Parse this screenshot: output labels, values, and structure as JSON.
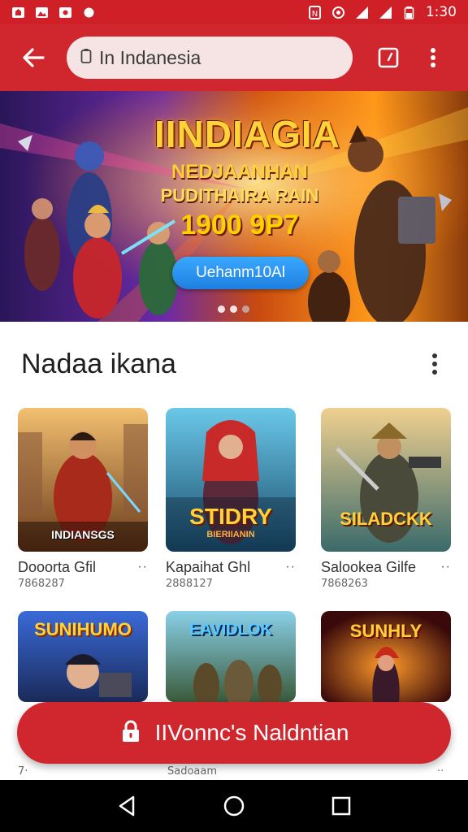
{
  "status_bar": {
    "time": "1:30",
    "left_icons": [
      "app-notification-icon",
      "gallery-icon",
      "photo-icon",
      "dot-icon"
    ],
    "right_icons": [
      "nfc-icon",
      "location-icon",
      "signal-icon",
      "signal-icon",
      "battery-icon"
    ]
  },
  "app_bar": {
    "url": "In Indanesia",
    "accent": "#d0262d"
  },
  "hero": {
    "title": "IINDIAGIA",
    "sub1": "NEDJAANHAN",
    "sub2": "PUDITHAIRA RAIN",
    "price": "1900 9P7",
    "cta": "Uehanm10Al",
    "slide_count": 3
  },
  "section": {
    "title": "Nadaa ikana"
  },
  "cards": [
    {
      "thumb_title": "INDIANSGS",
      "name": "Dooorta Gfil",
      "sub": "7868287",
      "more": "··"
    },
    {
      "thumb_title": "STIDRY",
      "thumb_sub": "BIERIIANIN",
      "name": "Kapaihat Ghl",
      "sub": "2888127",
      "more": "··"
    },
    {
      "thumb_title": "SILADCKK",
      "name": "Salookea Gilfe",
      "sub": "7868263",
      "more": "··"
    },
    {
      "thumb_title": "SUNIHUMO",
      "name": "",
      "sub": "",
      "more": ""
    },
    {
      "thumb_title": "EAVIDLOK",
      "name": "",
      "sub": "",
      "more": ""
    },
    {
      "thumb_title": "SUNHLY",
      "name": "",
      "sub": "",
      "more": "··"
    }
  ],
  "fab": {
    "label": "IIVonnc's Naldntian"
  },
  "peek": [
    "7·",
    "Sadoaam",
    "··"
  ],
  "nav_bar": {
    "buttons": [
      "back-icon",
      "home-icon",
      "recents-icon"
    ]
  }
}
